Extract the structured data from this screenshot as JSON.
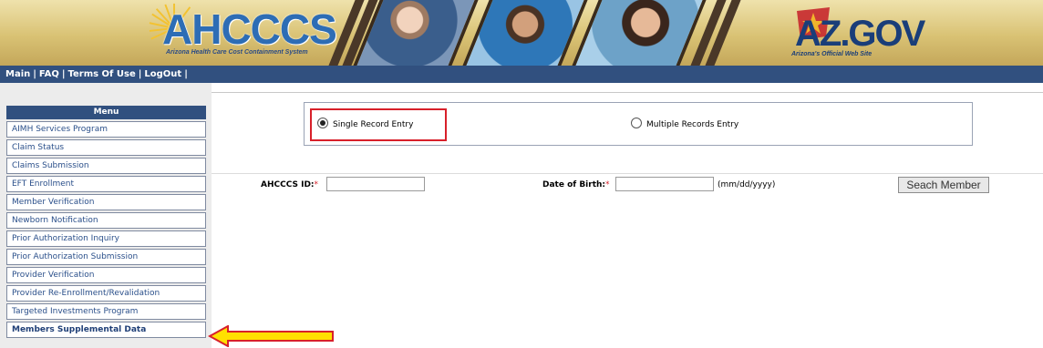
{
  "banner": {
    "logo_text": "AHCCCS",
    "logo_subtitle": "Arizona Health Care Cost Containment System",
    "az_logo_text": "AZ.GOV",
    "az_subtitle": "Arizona's Official Web Site"
  },
  "nav": {
    "links": [
      "Main",
      "FAQ",
      "Terms Of Use",
      "LogOut"
    ],
    "separator": "|"
  },
  "menu": {
    "title": "Menu",
    "items": [
      "AIMH Services Program",
      "Claim Status",
      "Claims Submission",
      "EFT Enrollment",
      "Member Verification",
      "Newborn Notification",
      "Prior Authorization Inquiry",
      "Prior Authorization Submission",
      "Provider Verification",
      "Provider Re-Enrollment/Revalidation",
      "Targeted Investments Program",
      "Members Supplemental Data"
    ]
  },
  "entry_mode": {
    "single_label": "Single Record Entry",
    "multiple_label": "Multiple Records Entry",
    "selected": "single"
  },
  "search_form": {
    "ahcccs_id_label": "AHCCCS ID:",
    "ahcccs_id_value": "",
    "dob_label": "Date of Birth:",
    "dob_value": "",
    "required_mark": "*",
    "dob_hint": "(mm/dd/yyyy)",
    "search_button": "Seach Member"
  },
  "colors": {
    "nav_blue": "#31507f",
    "highlight_red": "#d8202a",
    "arrow_yellow": "#ffe000"
  }
}
